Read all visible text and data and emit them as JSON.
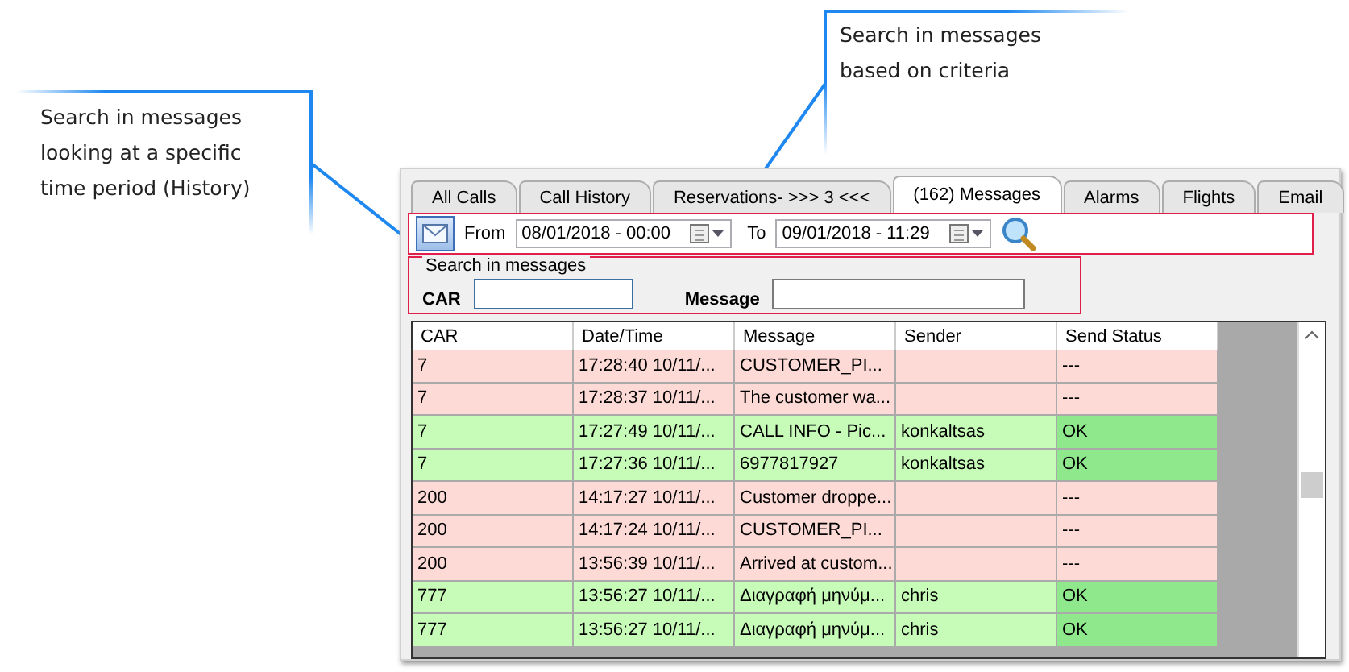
{
  "callouts": [
    {
      "lines": [
        "Search in messages",
        "looking at a specific",
        "time period (History)"
      ]
    },
    {
      "lines": [
        "Search in messages",
        "based on criteria"
      ]
    }
  ],
  "tabs": [
    {
      "label": "All Calls",
      "selected": false
    },
    {
      "label": "Call History",
      "selected": false
    },
    {
      "label": "Reservations- >>> 3 <<<",
      "selected": false
    },
    {
      "label": "(162) Messages",
      "selected": true
    },
    {
      "label": "Alarms",
      "selected": false
    },
    {
      "label": "Flights",
      "selected": false
    },
    {
      "label": "Email",
      "selected": false
    }
  ],
  "history": {
    "from_label": "From",
    "from_value": "08/01/2018 - 00:00",
    "to_label": "To",
    "to_value": "09/01/2018 - 11:29"
  },
  "search_group": {
    "title": "Search in messages",
    "fields": [
      {
        "label": "CAR"
      },
      {
        "label": "Message"
      }
    ]
  },
  "table": {
    "columns": [
      "CAR",
      "Date/Time",
      "Message",
      "Sender",
      "Send Status"
    ],
    "rows": [
      {
        "kind": "unsent",
        "cells": [
          "7",
          "17:28:40 10/11/...",
          "CUSTOMER_PI...",
          "",
          "---"
        ]
      },
      {
        "kind": "unsent",
        "cells": [
          "7",
          "17:28:37 10/11/...",
          "The customer wa...",
          "",
          "---"
        ]
      },
      {
        "kind": "sent",
        "cells": [
          "7",
          "17:27:49 10/11/...",
          "CALL INFO - Pic...",
          "konkaltsas",
          "OK"
        ]
      },
      {
        "kind": "sent",
        "cells": [
          "7",
          "17:27:36 10/11/...",
          "6977817927",
          "konkaltsas",
          "OK"
        ]
      },
      {
        "kind": "unsent",
        "cells": [
          "200",
          "14:17:27 10/11/...",
          "Customer droppe...",
          "",
          "---"
        ]
      },
      {
        "kind": "unsent",
        "cells": [
          "200",
          "14:17:24 10/11/...",
          "CUSTOMER_PI...",
          "",
          "---"
        ]
      },
      {
        "kind": "unsent",
        "cells": [
          "200",
          "13:56:39 10/11/...",
          "Arrived at custom...",
          "",
          "---"
        ]
      },
      {
        "kind": "sent",
        "cells": [
          "777",
          "13:56:27 10/11/...",
          "Διαγραφή μηνύμ...",
          "chris",
          "OK"
        ]
      },
      {
        "kind": "sent",
        "cells": [
          "777",
          "13:56:27 10/11/...",
          "Διαγραφή μηνύμ...",
          "chris",
          "OK"
        ]
      }
    ]
  }
}
